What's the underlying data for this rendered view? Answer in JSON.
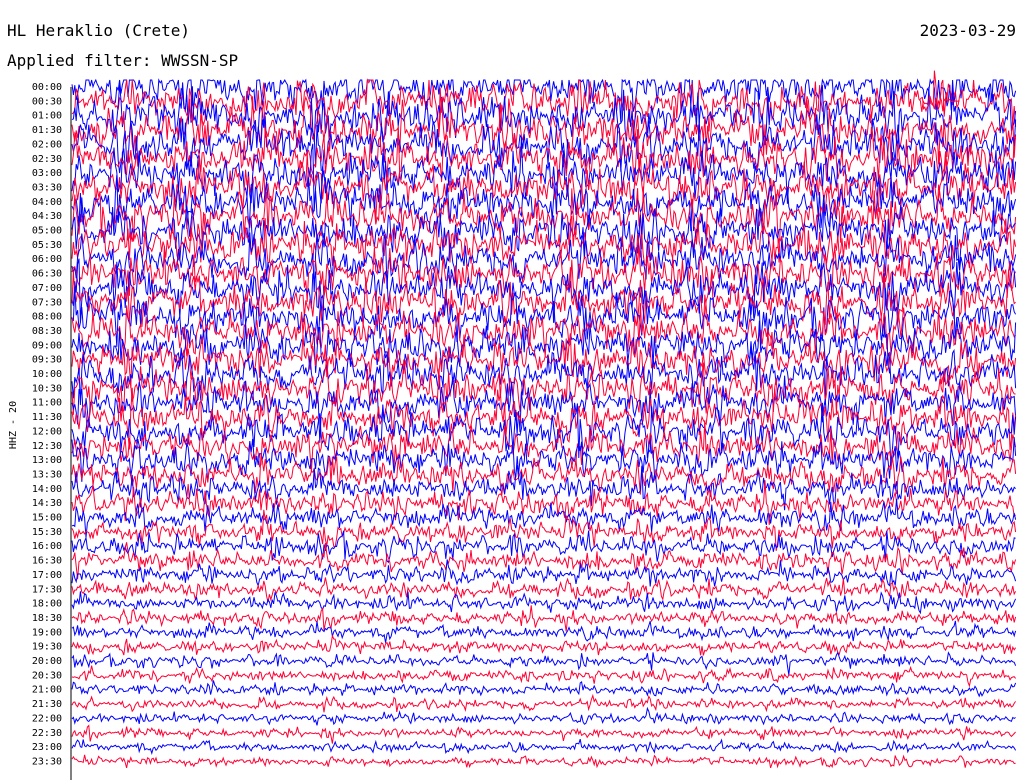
{
  "header": {
    "station": "HL Heraklio (Crete)",
    "date": "2023-03-29",
    "filter": "Applied filter: WWSSN-SP"
  },
  "chart_data": {
    "type": "helicorder",
    "channel_label": "HHZ - 20",
    "row_labels": [
      "00:00",
      "00:30",
      "01:00",
      "01:30",
      "02:00",
      "02:30",
      "03:00",
      "03:30",
      "04:00",
      "04:30",
      "05:00",
      "05:30",
      "06:00",
      "06:30",
      "07:00",
      "07:30",
      "08:00",
      "08:30",
      "09:00",
      "09:30",
      "10:00",
      "10:30",
      "11:00",
      "11:30",
      "12:00",
      "12:30",
      "13:00",
      "13:30",
      "14:00",
      "14:30",
      "15:00",
      "15:30",
      "16:00",
      "16:30",
      "17:00",
      "17:30",
      "18:00",
      "18:30",
      "19:00",
      "19:30",
      "20:00",
      "20:30",
      "21:00",
      "21:30",
      "22:00",
      "22:30",
      "23:00",
      "23:30"
    ],
    "colors": [
      "#0000ff",
      "#ff0033"
    ],
    "relative_amplitude_by_row": [
      1.0,
      1.0,
      1.0,
      1.0,
      1.0,
      1.0,
      1.0,
      1.0,
      1.0,
      1.0,
      0.95,
      0.95,
      0.95,
      0.95,
      0.95,
      0.95,
      0.95,
      0.95,
      0.9,
      0.9,
      0.9,
      0.9,
      0.85,
      0.85,
      0.85,
      0.8,
      0.75,
      0.7,
      0.65,
      0.6,
      0.55,
      0.52,
      0.5,
      0.46,
      0.42,
      0.4,
      0.36,
      0.34,
      0.32,
      0.3,
      0.28,
      0.27,
      0.26,
      0.25,
      0.24,
      0.23,
      0.22,
      0.21
    ],
    "annotations": []
  }
}
